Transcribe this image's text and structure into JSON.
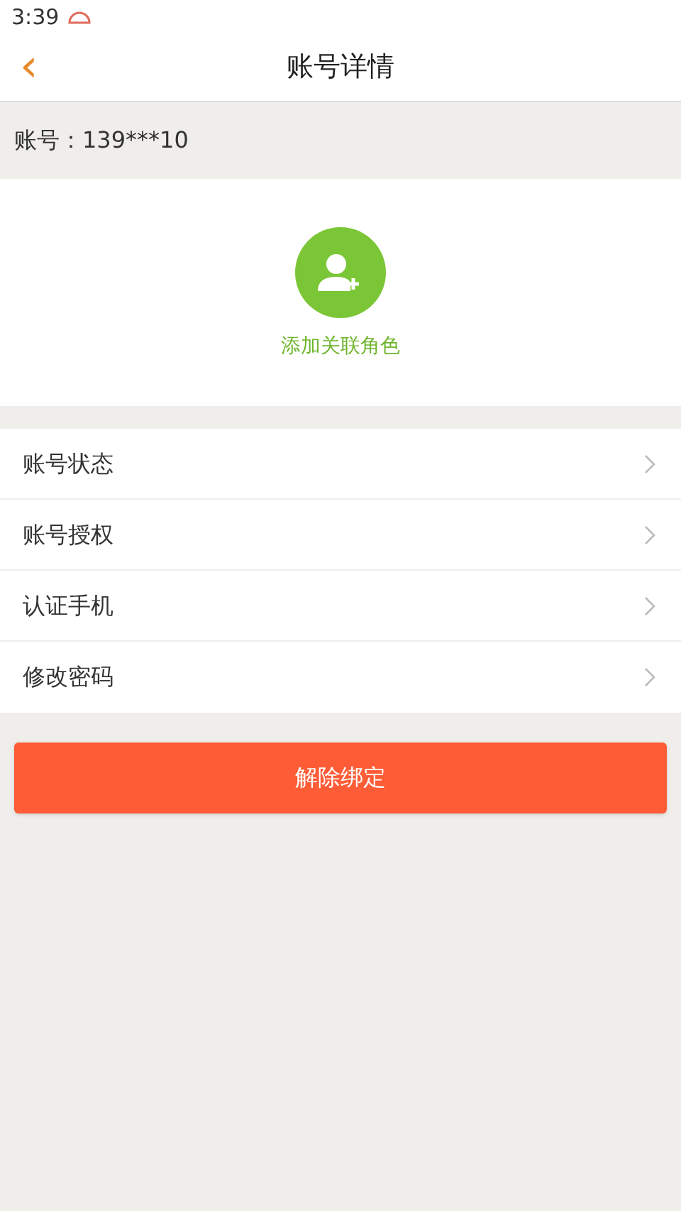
{
  "status_bar": {
    "time": "3:39"
  },
  "header": {
    "back": "‹",
    "title": "账号详情"
  },
  "account": {
    "label": "账号：139***10"
  },
  "add_role": {
    "label": "添加关联角色"
  },
  "menu": [
    {
      "label": "账号状态"
    },
    {
      "label": "账号授权"
    },
    {
      "label": "认证手机"
    },
    {
      "label": "修改密码"
    }
  ],
  "unbind_button": {
    "label": "解除绑定"
  }
}
